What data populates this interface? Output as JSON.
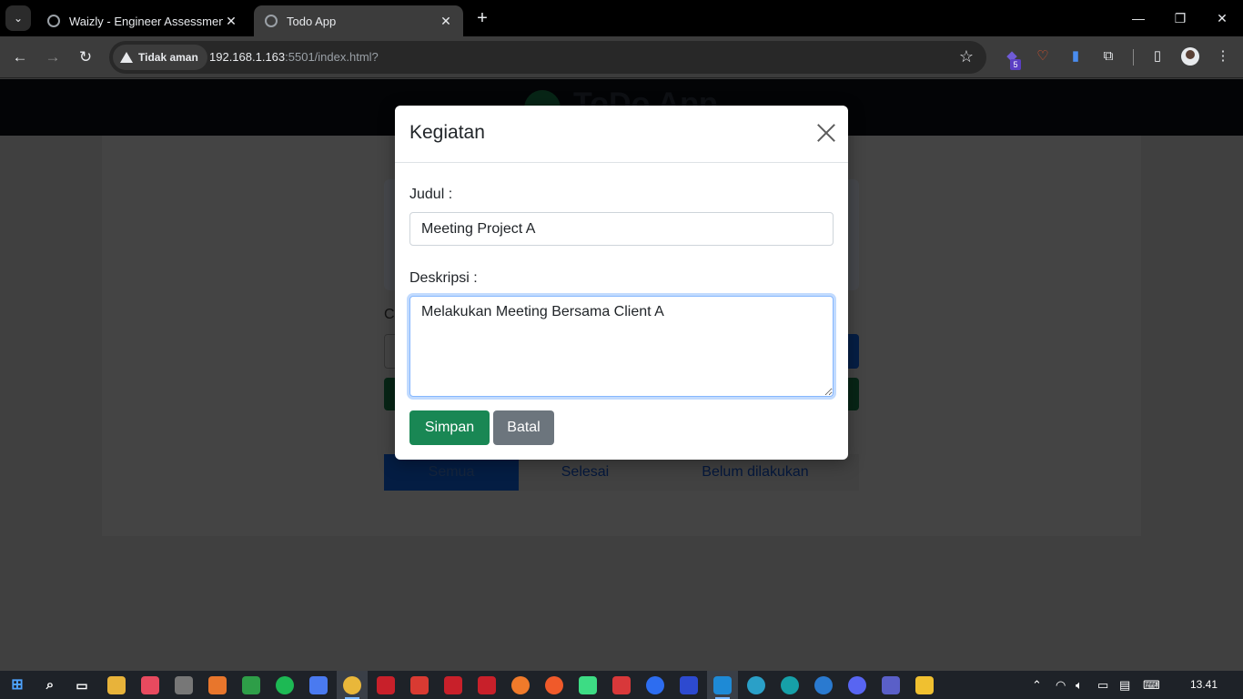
{
  "browser": {
    "tabs": [
      {
        "title": "Waizly - Engineer Assessment",
        "active": false
      },
      {
        "title": "Todo App",
        "active": true
      }
    ],
    "security_label": "Tidak aman",
    "url_host": "192.168.1.163",
    "url_rest": ":5501/index.html?",
    "extension_badge": "5"
  },
  "app": {
    "title": "ToDo App",
    "search_label": "C",
    "filters": [
      "Semua",
      "Selesai",
      "Belum dilakukan"
    ]
  },
  "modal": {
    "title": "Kegiatan",
    "judul_label": "Judul :",
    "judul_value": "Meeting Project A",
    "deskripsi_label": "Deskripsi :",
    "deskripsi_value": "Melakukan Meeting Bersama Client A",
    "save_label": "Simpan",
    "cancel_label": "Batal"
  },
  "taskbar": {
    "clock": "13.41"
  },
  "colors": {
    "primary_green": "#198754",
    "secondary_gray": "#6c757d",
    "primary_blue": "#0d6efd"
  }
}
